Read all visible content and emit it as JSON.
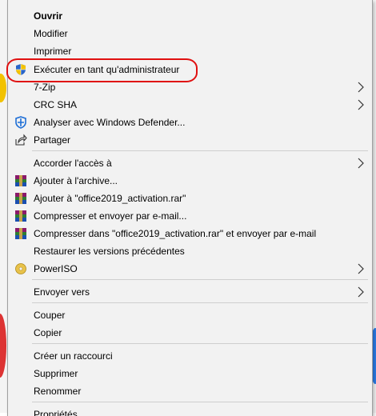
{
  "menu": {
    "items": [
      {
        "label": "Ouvrir"
      },
      {
        "label": "Modifier"
      },
      {
        "label": "Imprimer"
      },
      {
        "label": "Exécuter en tant qu'administrateur"
      },
      {
        "label": "7-Zip"
      },
      {
        "label": "CRC SHA"
      },
      {
        "label": "Analyser avec Windows Defender..."
      },
      {
        "label": "Partager"
      },
      {
        "label": "Accorder l'accès à"
      },
      {
        "label": "Ajouter à l'archive..."
      },
      {
        "label": "Ajouter à \"office2019_activation.rar\""
      },
      {
        "label": "Compresser et envoyer par e-mail..."
      },
      {
        "label": "Compresser dans \"office2019_activation.rar\" et envoyer par e-mail"
      },
      {
        "label": "Restaurer les versions précédentes"
      },
      {
        "label": "PowerISO"
      },
      {
        "label": "Envoyer vers"
      },
      {
        "label": "Couper"
      },
      {
        "label": "Copier"
      },
      {
        "label": "Créer un raccourci"
      },
      {
        "label": "Supprimer"
      },
      {
        "label": "Renommer"
      },
      {
        "label": "Propriétés"
      }
    ]
  },
  "colors": {
    "menu_background": "#f2f2f2",
    "annotation_red": "#e01010",
    "separator": "#cfcfcf"
  }
}
